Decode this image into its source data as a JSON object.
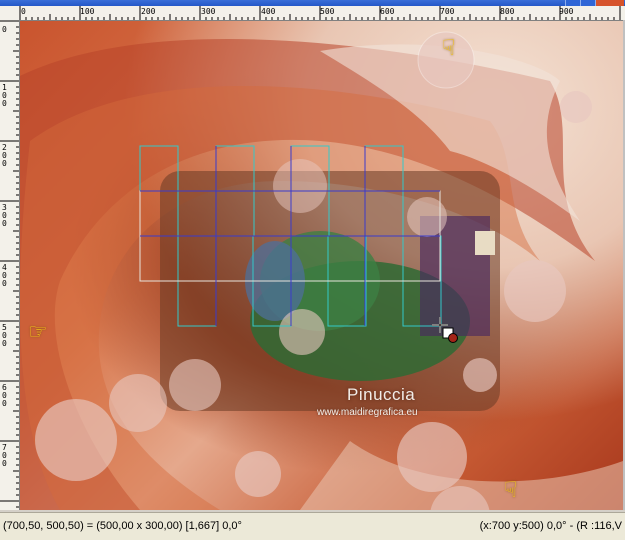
{
  "ruler_top": {
    "labels": [
      "0",
      "100",
      "200",
      "300",
      "400",
      "500",
      "600",
      "700",
      "800",
      "900"
    ]
  },
  "ruler_left": {
    "labels": [
      "0",
      "100",
      "200",
      "300",
      "400",
      "500",
      "600",
      "700"
    ]
  },
  "watermark": {
    "name": "Pinuccia",
    "url": "www.maidiregrafica.eu"
  },
  "status": {
    "selection": "(700,50, 500,50) = (500,00 x 300,00) [1,667]  0,0°",
    "cursor": "(x:700 y:500) 0,0° - (R :116,V"
  },
  "icons": {
    "pointer_top": "hand-point-down-icon",
    "pointer_left": "hand-point-right-icon",
    "pointer_bottom": "hand-point-down-icon",
    "cursor": "move-cursor-icon"
  },
  "colors": {
    "canvas_base": "#c9542e",
    "grid_cyan": "#33c9c9",
    "grid_blue": "#3a3acb",
    "ruler_bg": "#f3f1ea",
    "status_bg": "#ece9d8",
    "pointer": "#f3c11a"
  }
}
